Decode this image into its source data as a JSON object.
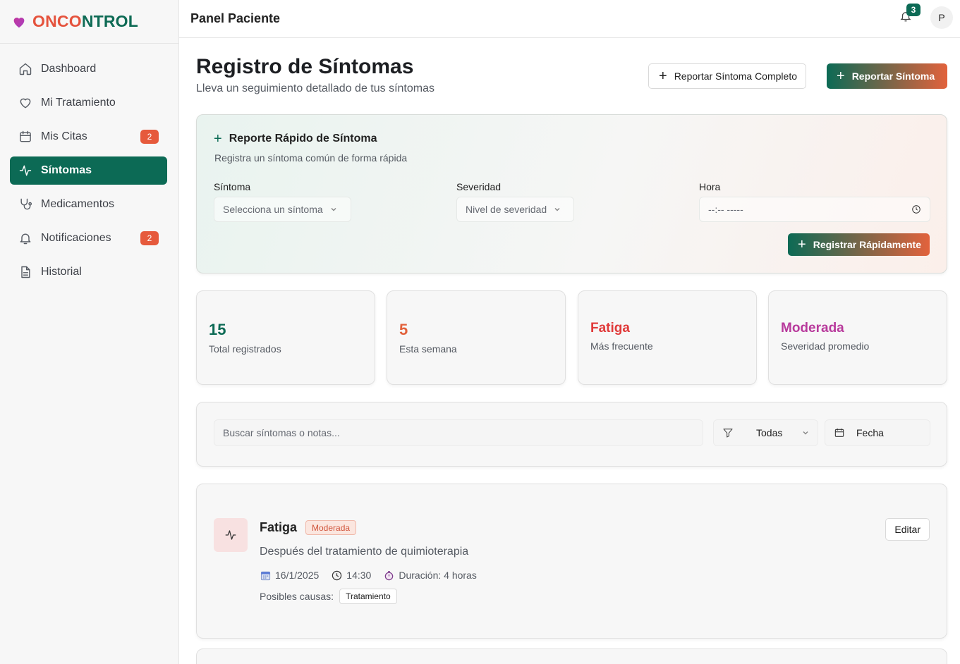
{
  "brand": {
    "part1": "ONCO",
    "part2": "NTROL"
  },
  "sidebar": {
    "items": [
      {
        "label": "Dashboard",
        "icon": "home-icon"
      },
      {
        "label": "Mi Tratamiento",
        "icon": "heart-icon"
      },
      {
        "label": "Mis Citas",
        "icon": "calendar-icon",
        "badge": "2"
      },
      {
        "label": "Síntomas",
        "icon": "activity-icon",
        "active": true
      },
      {
        "label": "Medicamentos",
        "icon": "stethoscope-icon"
      },
      {
        "label": "Notificaciones",
        "icon": "bell-icon",
        "badge": "2"
      },
      {
        "label": "Historial",
        "icon": "file-icon"
      }
    ]
  },
  "header": {
    "title": "Panel Paciente",
    "notifications_count": "3",
    "avatar_initial": "P"
  },
  "page": {
    "title": "Registro de Síntomas",
    "subtitle": "Lleva un seguimiento detallado de tus síntomas",
    "btn_full": "Reportar Síntoma Completo",
    "btn_report": "Reportar Síntoma"
  },
  "quick": {
    "title": "Reporte Rápido de Síntoma",
    "subtitle": "Registra un síntoma común de forma rápida",
    "symptom_label": "Síntoma",
    "symptom_placeholder": "Selecciona un síntoma",
    "severity_label": "Severidad",
    "severity_placeholder": "Nivel de severidad",
    "time_label": "Hora",
    "time_placeholder": "--:-- -----",
    "submit": "Registrar Rápidamente"
  },
  "stats": [
    {
      "value": "15",
      "label": "Total registrados",
      "color": "#0c6a55"
    },
    {
      "value": "5",
      "label": "Esta semana",
      "color": "#e2623c"
    },
    {
      "value": "Fatiga",
      "label": "Más frecuente",
      "color": "#e03a3a"
    },
    {
      "value": "Moderada",
      "label": "Severidad promedio",
      "color": "#b83a9c"
    }
  ],
  "filters": {
    "search_placeholder": "Buscar síntomas o notas...",
    "severity_value": "Todas",
    "date_label": "Fecha"
  },
  "symptom": {
    "name": "Fatiga",
    "severity": "Moderada",
    "description": "Después del tratamiento de quimioterapia",
    "date": "16/1/2025",
    "time": "14:30",
    "duration": "Duración: 4 horas",
    "causes_label": "Posibles causas:",
    "cause_tag": "Tratamiento",
    "edit": "Editar"
  }
}
